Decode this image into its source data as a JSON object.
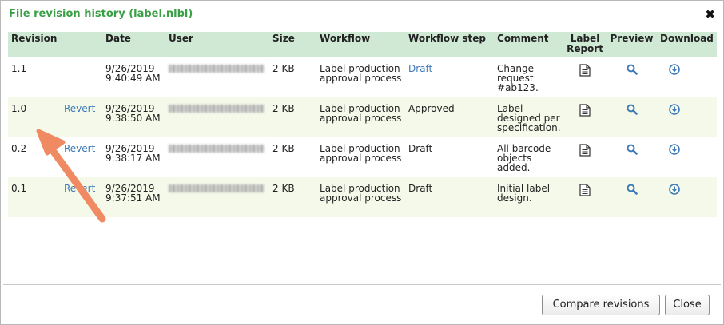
{
  "dialog": {
    "title": "File revision history (label.nlbl)"
  },
  "columns": [
    "Revision",
    "Date",
    "User",
    "Size",
    "Workflow",
    "Workflow step",
    "Comment",
    "Label Report",
    "Preview",
    "Download"
  ],
  "rows": [
    {
      "revision": "1.1",
      "revert": "",
      "date": "9/26/2019 9:40:49 AM",
      "size": "2 KB",
      "workflow": "Label production approval process",
      "step": "Draft",
      "step_is_link": true,
      "comment": "Change request #ab123."
    },
    {
      "revision": "1.0",
      "revert": "Revert",
      "date": "9/26/2019 9:38:50 AM",
      "size": "2 KB",
      "workflow": "Label production approval process",
      "step": "Approved",
      "step_is_link": false,
      "comment": "Label designed per specification."
    },
    {
      "revision": "0.2",
      "revert": "Revert",
      "date": "9/26/2019 9:38:17 AM",
      "size": "2 KB",
      "workflow": "Label production approval process",
      "step": "Draft",
      "step_is_link": false,
      "comment": "All barcode objects added."
    },
    {
      "revision": "0.1",
      "revert": "Revert",
      "date": "9/26/2019 9:37:51 AM",
      "size": "2 KB",
      "workflow": "Label production approval process",
      "step": "Draft",
      "step_is_link": false,
      "comment": "Initial label design."
    }
  ],
  "icons": {
    "close": "close-icon",
    "label_report": "document-icon",
    "preview": "search-icon",
    "download": "download-icon"
  },
  "colors": {
    "title": "#3aa046",
    "header_bg": "#cfe9d5",
    "alt_row_bg": "#f5f9ea",
    "link": "#3d7ab8",
    "arrow": "#f08a62"
  },
  "footer": {
    "compare_label": "Compare revisions",
    "close_label": "Close"
  }
}
